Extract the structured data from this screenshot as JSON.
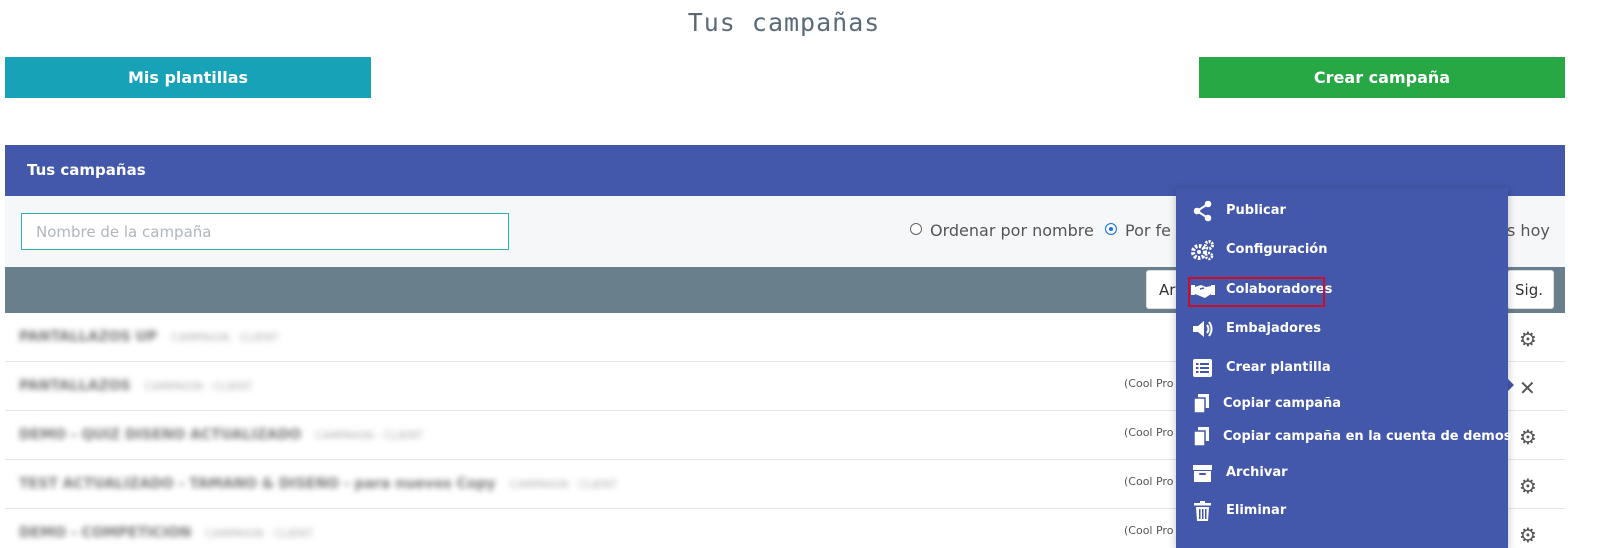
{
  "page": {
    "title": "Tus campañas",
    "templates_button": "Mis plantillas",
    "create_button": "Crear campaña"
  },
  "panel": {
    "header": "Tus campañas",
    "search_placeholder": "Nombre de la campaña",
    "search_value": "",
    "sort_by_name": "Ordenar por nombre",
    "sort_by_date": "Por fe",
    "today_suffix": "s hoy",
    "sort_selected": "date"
  },
  "pager": {
    "prev": "Ar",
    "next": "Sig."
  },
  "rows": [
    {
      "name": "PANTALLAZOS UP",
      "meta": "CAMPAIGN · CLIENT",
      "client": "",
      "action_icon": "gear-icon",
      "action": "⚙"
    },
    {
      "name": "PANTALLAZOS",
      "meta": "CAMPAIGN · CLIENT",
      "client": "(Cool Pro",
      "action_icon": "close-icon",
      "action": "✕"
    },
    {
      "name": "DEMO - QUIZ DISEÑO ACTUALIZADO",
      "meta": "CAMPAIGN · CLIENT",
      "client": "(Cool Pro",
      "action_icon": "gear-icon",
      "action": "⚙"
    },
    {
      "name": "TEST ACTUALIZADO - TAMAÑO & DISEÑO - para nuevos Copy",
      "meta": "CAMPAIGN · CLIENT",
      "client": "(Cool Pro",
      "action_icon": "gear-icon",
      "action": "⚙"
    },
    {
      "name": "DEMO - COMPETICIÓN",
      "meta": "CAMPAIGN · CLIENT",
      "client": "(Cool Pro",
      "action_icon": "gear-icon",
      "action": "⚙"
    }
  ],
  "menu": {
    "items": [
      {
        "label": "Publicar",
        "icon": "share-icon"
      },
      {
        "label": "Configuración",
        "icon": "gears-icon"
      },
      {
        "label": "Colaboradores",
        "icon": "handshake-icon"
      },
      {
        "label": "Embajadores",
        "icon": "megaphone-icon"
      },
      {
        "label": "Crear plantilla",
        "icon": "list-icon"
      },
      {
        "label": "Copiar campaña",
        "icon": "copy-icon"
      },
      {
        "label": "Copiar campaña en la cuenta de demos",
        "icon": "copy-icon"
      },
      {
        "label": "Archivar",
        "icon": "archive-icon"
      },
      {
        "label": "Eliminar",
        "icon": "trash-icon"
      }
    ],
    "highlighted": "Colaboradores"
  },
  "colors": {
    "header_blue": "#4358ab",
    "teal_button": "#17a2b8",
    "green_button": "#28a745",
    "toolbar_gray": "#6a7f8c",
    "highlight_red": "#c8102e"
  }
}
